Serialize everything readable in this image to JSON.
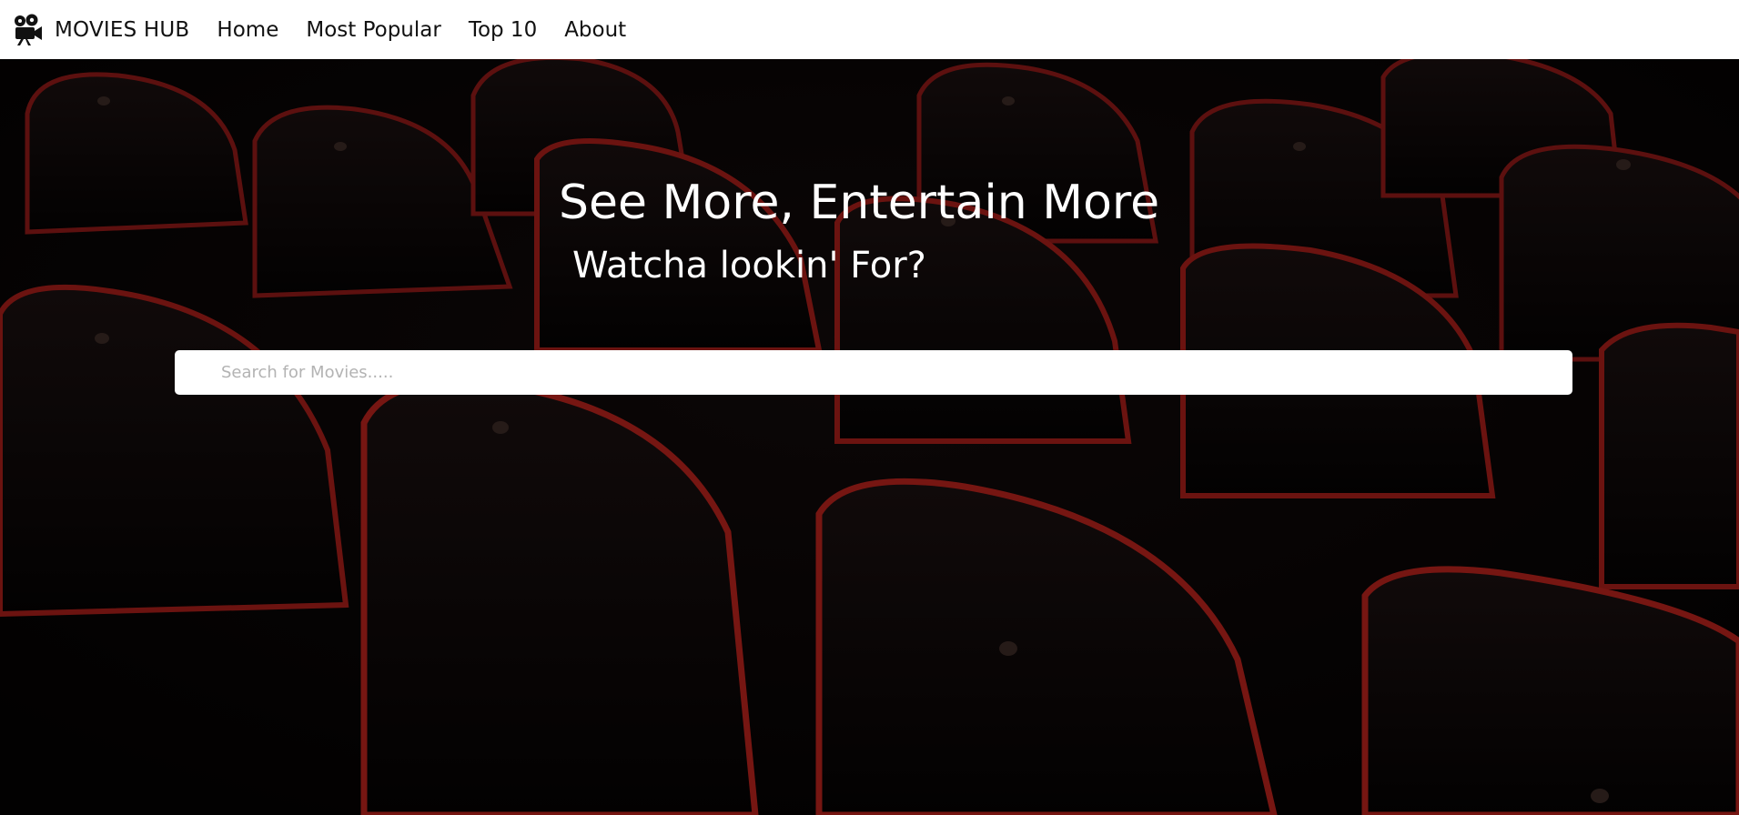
{
  "navbar": {
    "brand_icon": "movie-camera-icon",
    "brand": "MOVIES HUB",
    "links": [
      {
        "label": "Home"
      },
      {
        "label": "Most Popular"
      },
      {
        "label": "Top 10"
      },
      {
        "label": "About"
      }
    ]
  },
  "hero": {
    "background": "cinema-seats-photo",
    "headline": "See More, Entertain More",
    "subheadline": "Watcha lookin' For?"
  },
  "search": {
    "placeholder": "Search for Movies.....",
    "value": ""
  },
  "colors": {
    "navbar_bg": "#ffffff",
    "hero_bg": "#070404",
    "seat_trim": "#b0201c",
    "text_light": "#ffffff"
  }
}
